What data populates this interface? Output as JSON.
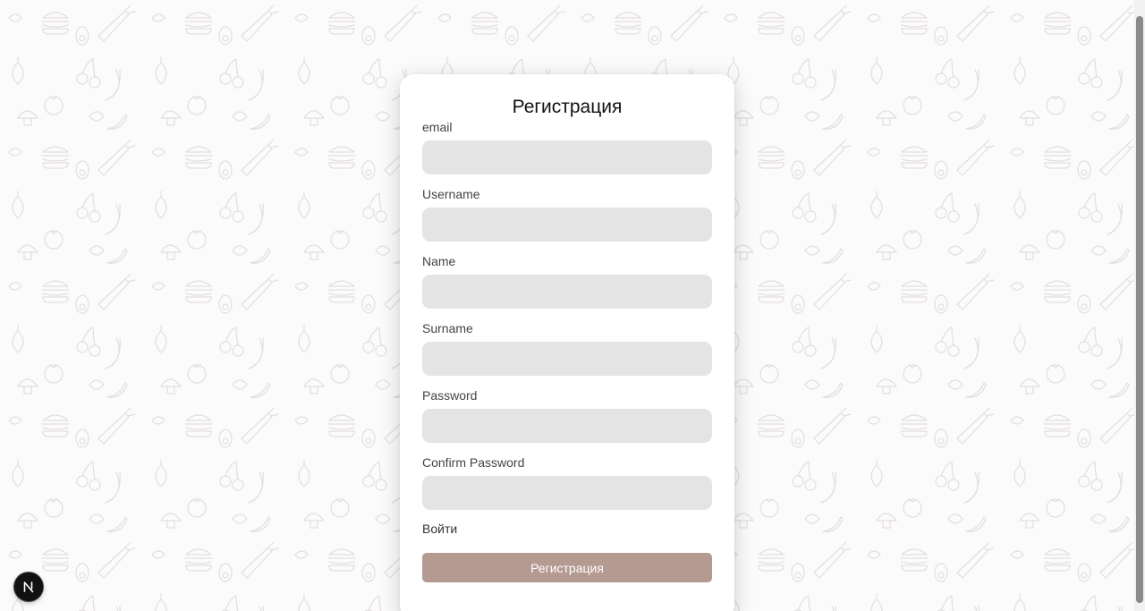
{
  "form": {
    "title": "Регистрация",
    "fields": [
      {
        "label": "email",
        "value": "",
        "type": "email"
      },
      {
        "label": "Username",
        "value": "",
        "type": "text"
      },
      {
        "label": "Name",
        "value": "",
        "type": "text"
      },
      {
        "label": "Surname",
        "value": "",
        "type": "text"
      },
      {
        "label": "Password",
        "value": "",
        "type": "password"
      },
      {
        "label": "Confirm Password",
        "value": "",
        "type": "password"
      }
    ],
    "login_link": "Войти",
    "submit_label": "Регистрация"
  },
  "colors": {
    "background": "#fbfbfb",
    "card": "#ffffff",
    "input_bg": "#e4e4e4",
    "button_bg": "#b59a92",
    "button_text": "#ffffff",
    "pattern_stroke": "#e6e2e0"
  },
  "icons": {
    "background_pattern": "food-doodle-pattern",
    "corner_badge": "nextjs-logo-icon"
  }
}
